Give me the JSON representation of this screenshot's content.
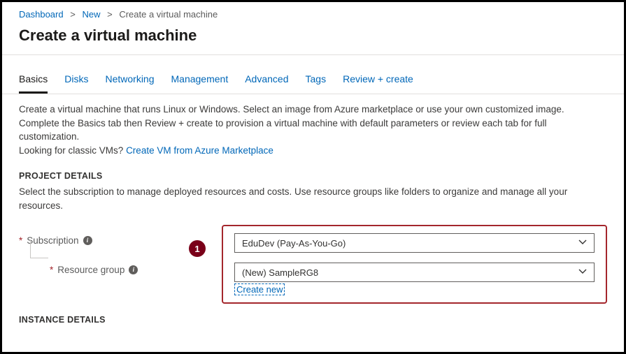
{
  "breadcrumb": {
    "items": [
      "Dashboard",
      "New",
      "Create a virtual machine"
    ]
  },
  "page_title": "Create a virtual machine",
  "tabs": [
    {
      "label": "Basics",
      "active": true
    },
    {
      "label": "Disks"
    },
    {
      "label": "Networking"
    },
    {
      "label": "Management"
    },
    {
      "label": "Advanced"
    },
    {
      "label": "Tags"
    },
    {
      "label": "Review + create"
    }
  ],
  "description": {
    "line1": "Create a virtual machine that runs Linux or Windows. Select an image from Azure marketplace or use your own customized image.",
    "line2": "Complete the Basics tab then Review + create to provision a virtual machine with default parameters or review each tab for full customization.",
    "line3_prefix": "Looking for classic VMs?  ",
    "line3_link": "Create VM from Azure Marketplace"
  },
  "project_details": {
    "title": "PROJECT DETAILS",
    "desc": "Select the subscription to manage deployed resources and costs. Use resource groups like folders to organize and manage all your resources.",
    "subscription_label": "Subscription",
    "resource_group_label": "Resource group",
    "subscription_value": "EduDev (Pay-As-You-Go)",
    "resource_group_value": "(New) SampleRG8",
    "create_new": "Create new"
  },
  "callout_number": "1",
  "instance_details_title": "INSTANCE DETAILS"
}
